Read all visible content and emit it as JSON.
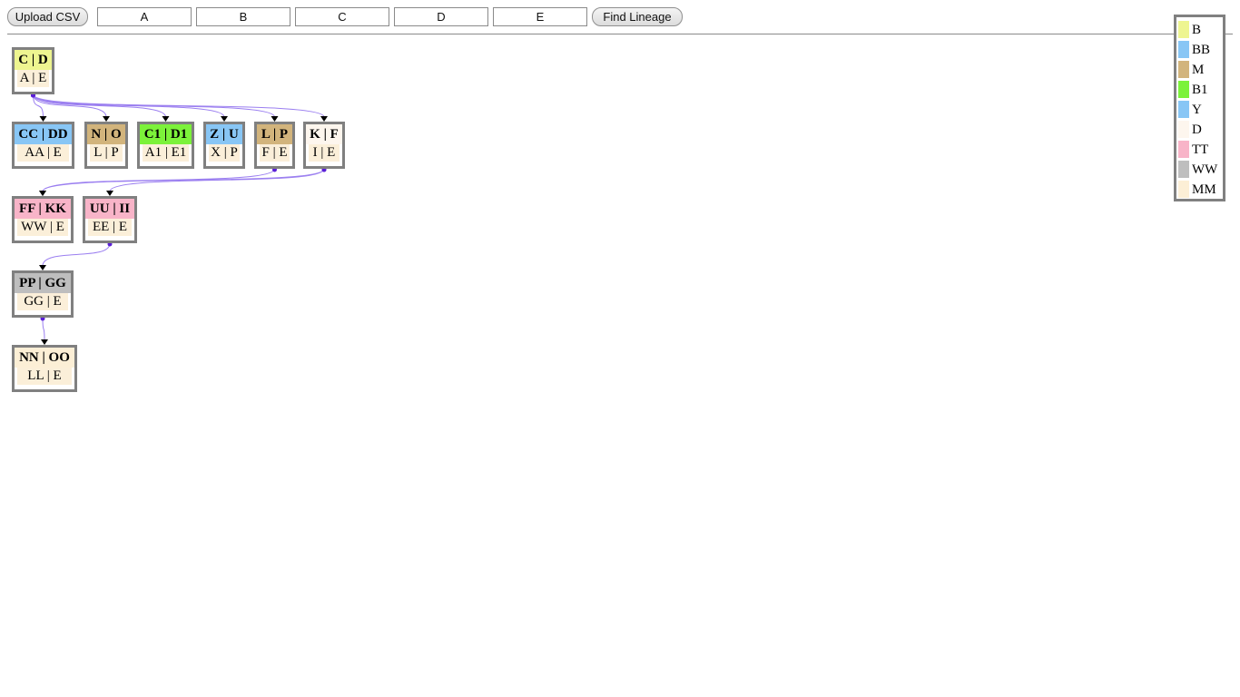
{
  "toolbar": {
    "upload_label": "Upload CSV",
    "fields": [
      "A",
      "B",
      "C",
      "D",
      "E"
    ],
    "find_label": "Find Lineage"
  },
  "nodes": [
    {
      "id": "cd",
      "top": "C | D",
      "bottom": "A | E",
      "color": "#eef590"
    },
    {
      "id": "ccdd",
      "top": "CC | DD",
      "bottom": "AA | E",
      "color": "#88c6f5"
    },
    {
      "id": "no",
      "top": "N | O",
      "bottom": "L | P",
      "color": "#d2b47c"
    },
    {
      "id": "c1d1",
      "top": "C1 | D1",
      "bottom": "A1 | E1",
      "color": "#7cf23a"
    },
    {
      "id": "zu",
      "top": "Z | U",
      "bottom": "X | P",
      "color": "#88c6f5"
    },
    {
      "id": "lp",
      "top": "L | P",
      "bottom": "F | E",
      "color": "#d2b47c"
    },
    {
      "id": "kf",
      "top": "K | F",
      "bottom": "I | E",
      "color": "#fdf6ee"
    },
    {
      "id": "ffkk",
      "top": "FF | KK",
      "bottom": "WW | E",
      "color": "#f8b4c8"
    },
    {
      "id": "uuii",
      "top": "UU | II",
      "bottom": "EE | E",
      "color": "#f8b4c8"
    },
    {
      "id": "ppgg",
      "top": "PP | GG",
      "bottom": "GG | E",
      "color": "#bebebe"
    },
    {
      "id": "nnoo",
      "top": "NN | OO",
      "bottom": "LL | E",
      "color": "#fcefd6"
    }
  ],
  "edges": [
    [
      "cd",
      "ccdd"
    ],
    [
      "cd",
      "no"
    ],
    [
      "cd",
      "c1d1"
    ],
    [
      "cd",
      "zu"
    ],
    [
      "cd",
      "lp"
    ],
    [
      "cd",
      "kf"
    ],
    [
      "lp",
      "ffkk"
    ],
    [
      "kf",
      "ffkk"
    ],
    [
      "kf",
      "uuii"
    ],
    [
      "uuii",
      "ppgg"
    ],
    [
      "ppgg",
      "nnoo"
    ]
  ],
  "edge_color": "#9b7ff0",
  "legend": [
    {
      "label": "B",
      "color": "#eef590"
    },
    {
      "label": "BB",
      "color": "#88c6f5"
    },
    {
      "label": "M",
      "color": "#d2b47c"
    },
    {
      "label": "B1",
      "color": "#7cf23a"
    },
    {
      "label": "Y",
      "color": "#88c6f5"
    },
    {
      "label": "D",
      "color": "#fdf6ee"
    },
    {
      "label": "TT",
      "color": "#f8b4c8"
    },
    {
      "label": "WW",
      "color": "#bebebe"
    },
    {
      "label": "MM",
      "color": "#fcefd6"
    }
  ]
}
